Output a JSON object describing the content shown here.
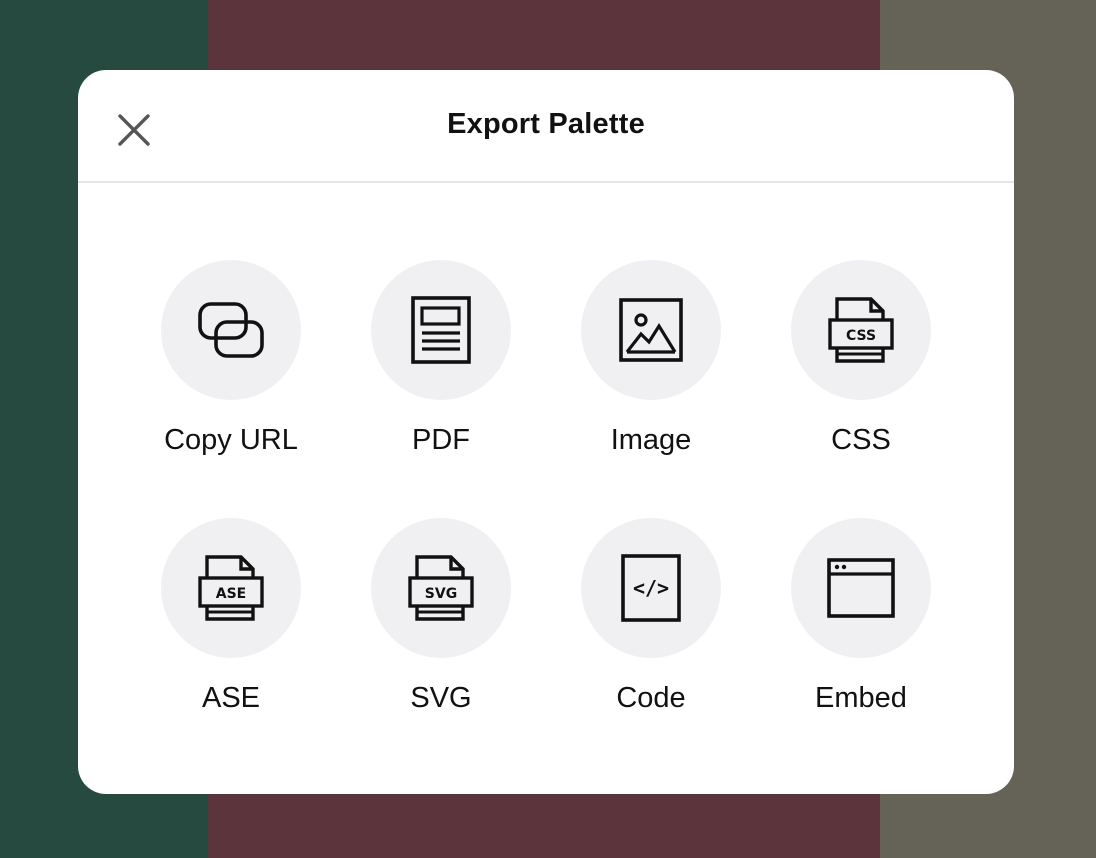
{
  "backdrop": {
    "swatches": [
      "#274a40",
      "#5b353b",
      "#656357"
    ]
  },
  "dialog": {
    "title": "Export Palette",
    "close_icon": "close-icon"
  },
  "options": [
    {
      "label": "Copy URL",
      "icon": "link-icon"
    },
    {
      "label": "PDF",
      "icon": "document-icon"
    },
    {
      "label": "Image",
      "icon": "image-icon"
    },
    {
      "label": "CSS",
      "icon": "css-file-icon",
      "badge": "CSS"
    },
    {
      "label": "ASE",
      "icon": "ase-file-icon",
      "badge": "ASE"
    },
    {
      "label": "SVG",
      "icon": "svg-file-icon",
      "badge": "SVG"
    },
    {
      "label": "Code",
      "icon": "code-icon",
      "glyph": "</>"
    },
    {
      "label": "Embed",
      "icon": "browser-window-icon"
    }
  ]
}
